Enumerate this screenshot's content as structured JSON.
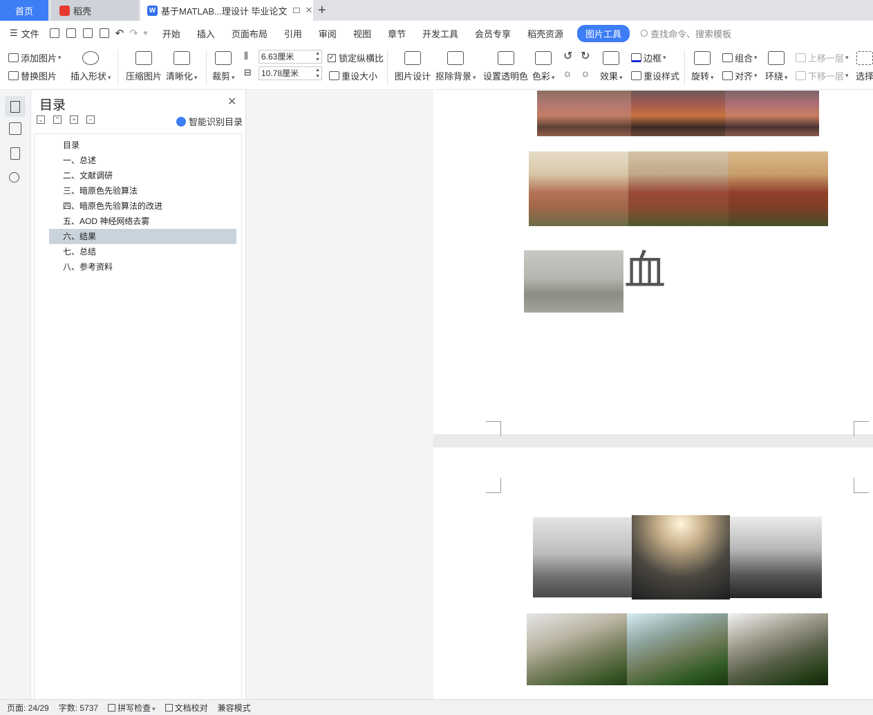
{
  "tabs": {
    "home": "首页",
    "daoke": "稻壳",
    "doc": "基于MATLAB...理设计 毕业论文",
    "doc_icon": "W",
    "add": "+"
  },
  "menu": {
    "file": "文件",
    "items": [
      "开始",
      "插入",
      "页面布局",
      "引用",
      "审阅",
      "视图",
      "章节",
      "开发工具",
      "会员专享",
      "稻壳资源"
    ],
    "picture_tools": "图片工具",
    "search_placeholder": "查找命令、搜索模板"
  },
  "ribbon": {
    "add_picture": "添加图片",
    "replace_picture": "替换图片",
    "insert_shape": "插入形状",
    "compress": "压缩图片",
    "sharpen": "清晰化",
    "crop": "裁剪",
    "height": "6.63厘米",
    "width": "10.78厘米",
    "lock_ratio": "锁定纵横比",
    "reset_size": "重设大小",
    "pic_design": "图片设计",
    "remove_bg": "抠除背景",
    "set_transparent": "设置透明色",
    "color": "色彩",
    "effects": "效果",
    "border": "边框",
    "reset_style": "重设样式",
    "rotate": "旋转",
    "group": "组合",
    "align": "对齐",
    "wrap": "环绕",
    "bring_forward": "上移一层",
    "send_backward": "下移一层",
    "select": "选择"
  },
  "toc": {
    "title": "目录",
    "smart": "智能识别目录",
    "items": [
      "目录",
      "一、总述",
      "二、文献调研",
      "三、暗原色先验算法",
      "四、暗原色先验算法的改进",
      "五、AOD 神经网络去雾",
      "六、结果",
      "七、总结",
      "八、参考资料"
    ],
    "active_index": 6
  },
  "document": {
    "glyph": "血"
  },
  "status": {
    "page": "页面: 24/29",
    "words": "字数: 5737",
    "spell": "拼写检查",
    "proof": "文档校对",
    "compat": "兼容模式"
  },
  "colors": {
    "accent": "#3d7df5",
    "toc_active": "#c9d3dc"
  }
}
